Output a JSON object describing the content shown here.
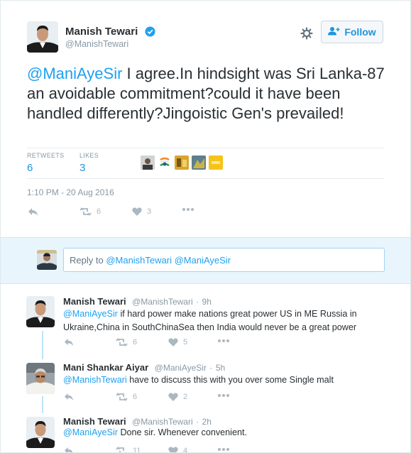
{
  "tweet": {
    "author_name": "Manish Tewari",
    "author_handle": "@ManishTewari",
    "mention": "@ManiAyeSir",
    "text": " I agree.In hindsight was Sri Lanka-87 an avoidable commitment?could it have been handled differently?Jingoistic Gen's prevailed!",
    "retweets_label": "RETWEETS",
    "retweets_count": "6",
    "likes_label": "LIKES",
    "likes_count": "3",
    "timestamp": "1:10 PM - 20 Aug 2016",
    "actions": {
      "retweet_count": "6",
      "like_count": "3"
    }
  },
  "follow_button": {
    "label": "Follow",
    "icon": "add-user-icon"
  },
  "settings_icon": "gear-icon",
  "liker_avatars": [
    "liker-1",
    "liker-2",
    "liker-3",
    "liker-4",
    "liker-5"
  ],
  "reply_box": {
    "prefix": "Reply to ",
    "mentions": "@ManishTewari @ManiAyeSir"
  },
  "replies": [
    {
      "name": "Manish Tewari",
      "handle": "@ManishTewari",
      "time": "9h",
      "mention": "@ManiAyeSir",
      "text": " if hard power make nations great power US in ME Russia in Ukraine,China in SouthChinaSea then India would never be a great power",
      "retweets": "6",
      "likes": "5"
    },
    {
      "name": "Mani Shankar Aiyar",
      "handle": "@ManiAyeSir",
      "time": "5h",
      "mention": "@ManishTewari",
      "text": " have to discuss this with you over some Single malt",
      "retweets": "6",
      "likes": "2"
    },
    {
      "name": "Manish Tewari",
      "handle": "@ManishTewari",
      "time": "2h",
      "mention": "@ManiAyeSir",
      "text": " Done sir. Whenever convenient.",
      "retweets": "11",
      "likes": "4"
    }
  ],
  "colors": {
    "accent": "#1da1f2",
    "reply_area_bg": "#e8f5fd",
    "muted": "#8899a6"
  }
}
